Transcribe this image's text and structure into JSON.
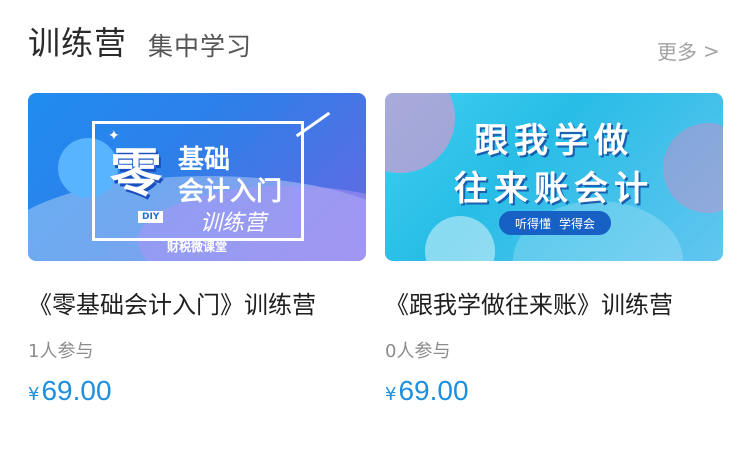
{
  "header": {
    "title": "训练营",
    "subtitle": "集中学习",
    "more_label": "更多",
    "more_icon": "chevron-right-icon",
    "more_glyph": ">"
  },
  "colors": {
    "price": "#1e8fdd",
    "text_primary": "#1f1f1f",
    "text_muted": "#8c8c8c"
  },
  "courses": [
    {
      "title": "《零基础会计入门》训练营",
      "joined": "1人参与",
      "currency": "¥",
      "price": "69.00",
      "banner": {
        "big": "零",
        "line1": "基础",
        "line2": "会计入门",
        "line3": "训练营",
        "tag": "DIY",
        "brand": "财税微课堂",
        "star": "✦"
      }
    },
    {
      "title": "《跟我学做往来账》训练营",
      "joined": "0人参与",
      "currency": "¥",
      "price": "69.00",
      "banner": {
        "line1": "跟我学做",
        "line2": "往来账会计",
        "pill_a": "听得懂",
        "pill_b": "学得会"
      }
    }
  ]
}
